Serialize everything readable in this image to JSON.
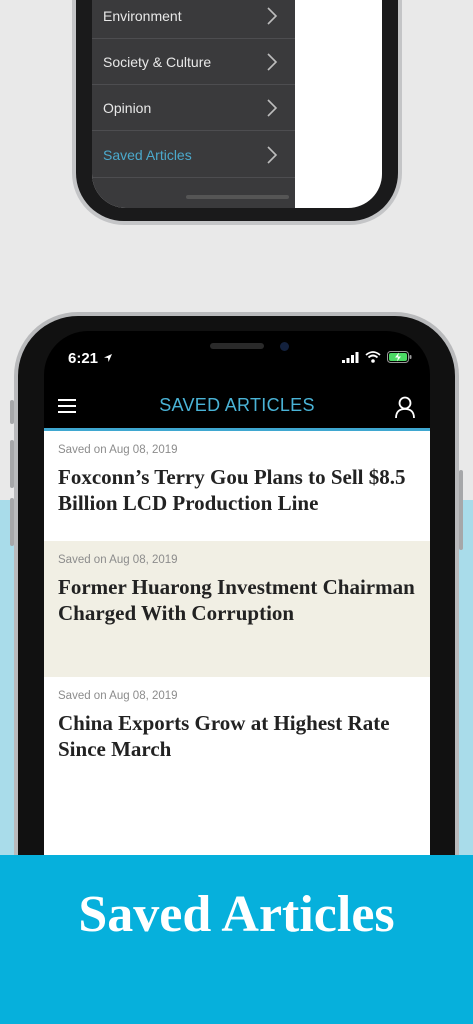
{
  "menu": {
    "items": [
      {
        "label": "Environment"
      },
      {
        "label": "Society & Culture"
      },
      {
        "label": "Opinion"
      },
      {
        "label": "Saved Articles"
      }
    ]
  },
  "status_bar": {
    "time": "6:21"
  },
  "app_bar": {
    "title": "SAVED ARTICLES"
  },
  "articles": [
    {
      "saved": "Saved on Aug 08, 2019",
      "headline": "Foxconn’s Terry Gou Plans to Sell $8.5 Billion LCD Production Line"
    },
    {
      "saved": "Saved on Aug 08, 2019",
      "headline": "Former Huarong Investment Chairman Charged With Corruption"
    },
    {
      "saved": "Saved on Aug 08, 2019",
      "headline": "China Exports Grow at Highest Rate Since March"
    }
  ],
  "caption": "Saved Articles",
  "colors": {
    "accent": "#4ab3d6",
    "banner": "#06b0dc",
    "highlight_row": "#f1efe4"
  }
}
